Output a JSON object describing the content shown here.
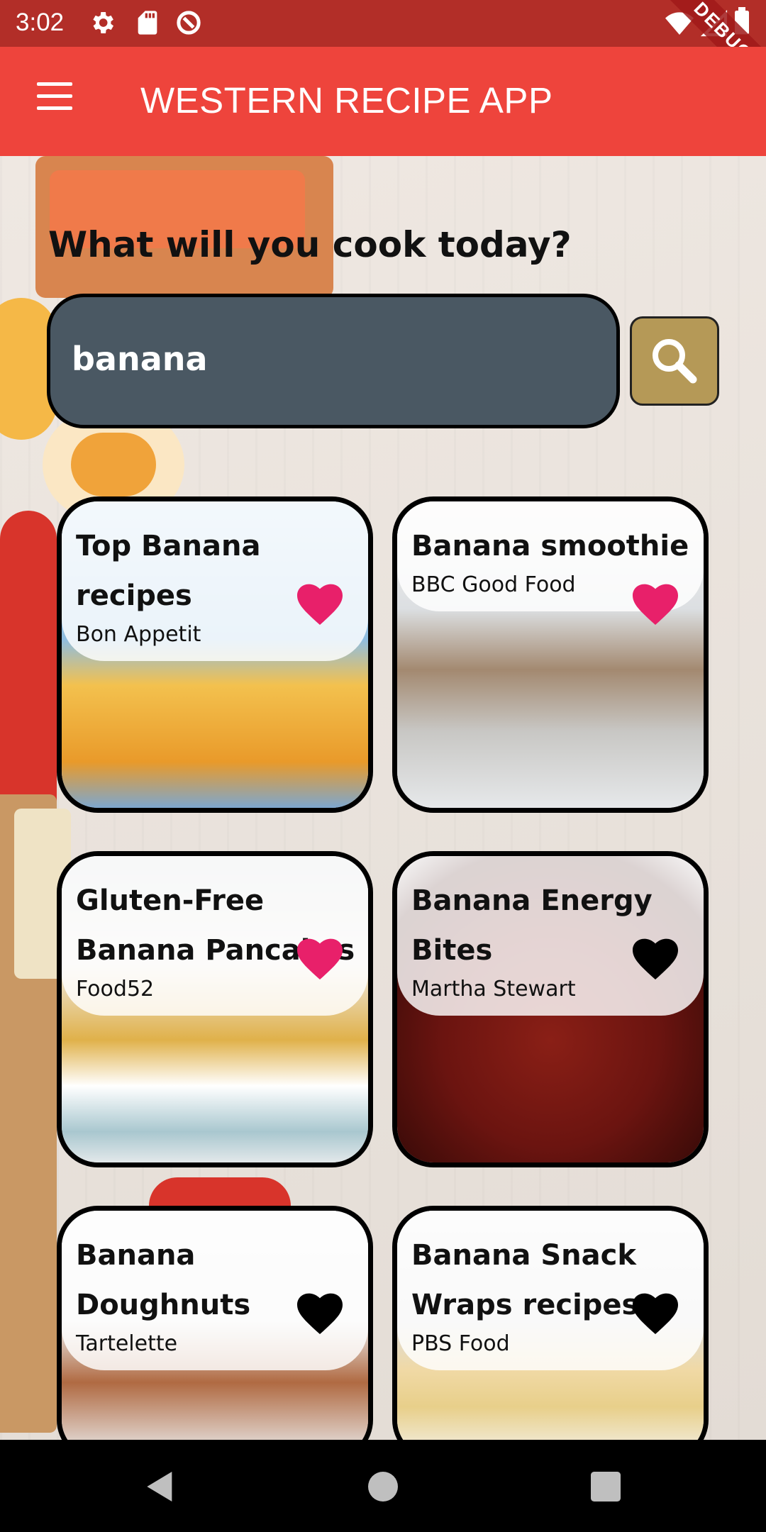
{
  "status_bar": {
    "time": "3:02",
    "icons": [
      "settings-icon",
      "sd-card-icon",
      "data-saver-icon",
      "wifi-icon",
      "signal-icon",
      "battery-icon"
    ],
    "debug_label": "DEBUG"
  },
  "app_bar": {
    "title": "WESTERN RECIPE APP",
    "menu_icon": "hamburger-menu-icon"
  },
  "main": {
    "heading": "What will you cook today?",
    "search": {
      "value": "banana",
      "placeholder": "",
      "button_icon": "search-icon"
    },
    "recipes": [
      {
        "title": "Top Banana recipes",
        "source": "Bon Appetit",
        "favorited": true
      },
      {
        "title": "Banana smoothie",
        "source": "BBC Good Food",
        "favorited": true
      },
      {
        "title": "Gluten-Free Banana Pancakes",
        "source": "Food52",
        "favorited": true
      },
      {
        "title": "Banana Energy Bites",
        "source": "Martha Stewart",
        "favorited": false
      },
      {
        "title": "Banana Doughnuts",
        "source": "Tartelette",
        "favorited": false
      },
      {
        "title": "Banana Snack Wraps recipes",
        "source": "PBS Food",
        "favorited": false
      }
    ]
  },
  "nav_bar": {
    "back_icon": "back-icon",
    "home_icon": "home-icon",
    "recents_icon": "recents-icon"
  },
  "colors": {
    "status_bar": "#b22e28",
    "app_bar": "#ee443c",
    "search_field": "#4a5863",
    "search_button": "#b59957",
    "favorite_active": "#e8206a",
    "favorite_inactive": "#000000"
  }
}
